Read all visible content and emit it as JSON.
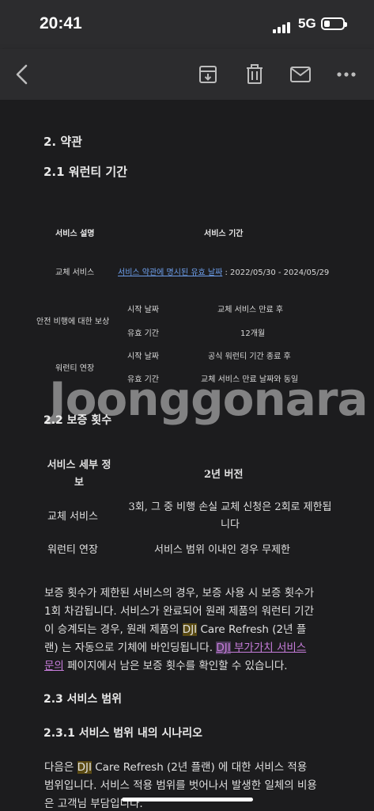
{
  "status": {
    "time": "20:41",
    "network": "5G",
    "battery_level": 0.3
  },
  "toolbar": {
    "back_icon": "chevron-left-icon",
    "archive_icon": "archive-icon",
    "delete_icon": "trash-icon",
    "mail_icon": "mail-icon",
    "more_icon": "more-dots-icon"
  },
  "doc": {
    "section_title": "2. 약관",
    "warranty_title": "2.1 워런티 기간",
    "table1": {
      "col1_header": "서비스 설명",
      "col2_header": "서비스 기간",
      "row1_name": "교체 서비스",
      "row1_link": "서비스 약관에 명시된 유효 날짜",
      "row1_value": " : 2022/05/30 - 2024/05/29",
      "row2_name": "안전 비행에 대한 보상",
      "row2_sub1": "시작 날짜",
      "row2_val1": "교체 서비스 만료 후",
      "row2_sub2": "유효 기간",
      "row2_val2": "12개월",
      "row3_name": "워런티 연장",
      "row3_sub1": "시작 날짜",
      "row3_val1": "공식 워런티 기간 종료 후",
      "row3_sub2": "유효 기간",
      "row3_val2": "교체 서비스 만료 날짜와 동일"
    },
    "count_title": "2.2 보증 횟수",
    "table2": {
      "header1_line1": "서비스 세부 정",
      "header1_line2": "보",
      "header2": "2년 버전",
      "row1_name": "교체 서비스",
      "row1_val_line1": "3회, 그 중 비행 손실 교체 신청은 2회로 제한됩",
      "row1_val_line2": "니다",
      "row2_name": "워런티 연장",
      "row2_val": "서비스 범위 이내인 경우 무제한"
    },
    "para1": {
      "line1": "보증 횟수가 제한된 서비스의 경우, 보증 사용 시 보증 횟수가",
      "line2": "1회 차감됩니다. 서비스가 완료되어 원래 제품의 워런티 기간",
      "line3_a": "이 승계되는 경우, 원래 제품의 ",
      "line3_hl": "DJI",
      "line3_b": " Care Refresh (2년 플",
      "line4_a": "랜) 는 자동으로 기체에 바인딩됩니다. ",
      "line4_link_hl": "DJI",
      "line4_link": " 부가가치 서비스",
      "line5_link": "문의",
      "line5_b": " 페이지에서 남은 보증 횟수를 확인할 수 있습니다."
    },
    "scope_title": "2.3 서비스 범위",
    "scope_sub_title": "2.3.1 서비스 범위 내의 시나리오",
    "para2": {
      "line1_a": "다음은 ",
      "line1_hl": "DJI",
      "line1_b": " Care Refresh (2년 플랜) 에 대한 서비스 적용",
      "line2": "범위입니다. 서비스 적용 범위를 벗어나서 발생한 일체의 비용",
      "line3": "은 고객님 부담입니다."
    }
  },
  "watermark": "Joonggonara"
}
